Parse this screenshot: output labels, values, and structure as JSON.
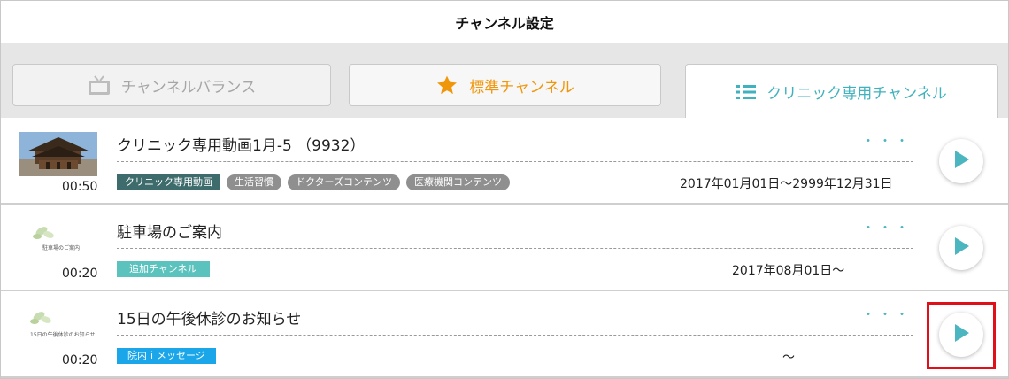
{
  "header": {
    "title": "チャンネル設定"
  },
  "tabs": [
    {
      "label": "チャンネルバランス",
      "icon": "tv-icon"
    },
    {
      "label": "標準チャンネル",
      "icon": "star-icon"
    },
    {
      "label": "クリニック専用チャンネル",
      "icon": "list-icon"
    }
  ],
  "colors": {
    "accent": "#3fb2bd",
    "star": "#f0960a",
    "highlight": "#e0101a"
  },
  "rows": [
    {
      "title": "クリニック専用動画1月‐5 （9932）",
      "duration": "00:50",
      "more": "・・・",
      "tags": [
        "クリニック専用動画",
        "生活習慣",
        "ドクターズコンテンツ",
        "医療機関コンテンツ"
      ],
      "date": "2017年01月01日〜2999年12月31日",
      "thumb_caption": ""
    },
    {
      "title": "駐車場のご案内",
      "duration": "00:20",
      "more": "・・・",
      "tags": [
        "追加チャンネル"
      ],
      "date": "2017年08月01日〜",
      "thumb_caption": "駐車場のご案内"
    },
    {
      "title": "15日の午後休診のお知らせ",
      "duration": "00:20",
      "more": "・・・",
      "tags": [
        "院内ｉメッセージ"
      ],
      "date": "〜",
      "thumb_caption": "15日の午後休診のお知らせ"
    }
  ]
}
